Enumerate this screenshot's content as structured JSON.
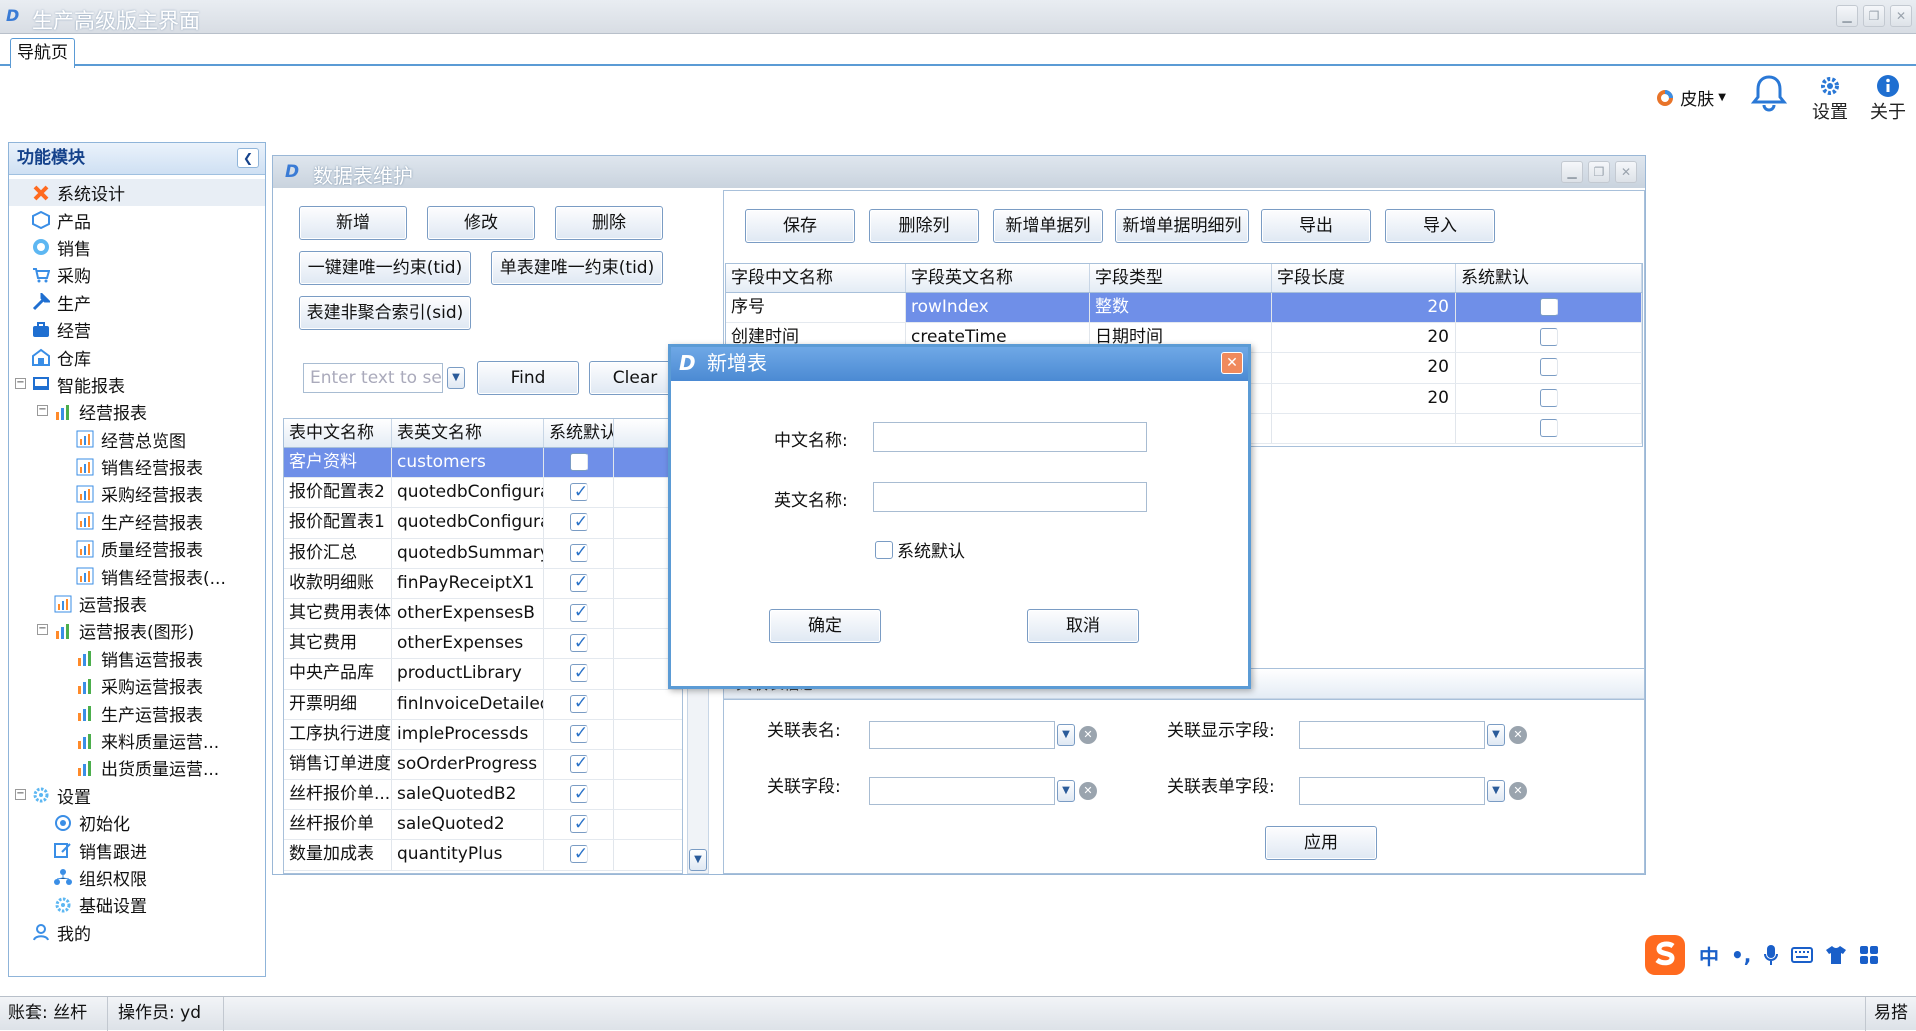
{
  "window": {
    "title": "生产高级版主界面"
  },
  "tabs": [
    {
      "label": "导航页"
    }
  ],
  "top_toolbar": {
    "skin": "皮肤",
    "settings": "设置",
    "about": "关于"
  },
  "left_panel": {
    "header": "功能模块",
    "tree": [
      {
        "label": "系统设计",
        "level": 1,
        "icon": "system-design-icon",
        "selected": true
      },
      {
        "label": "产品",
        "level": 1,
        "icon": "product-icon"
      },
      {
        "label": "销售",
        "level": 1,
        "icon": "sales-icon"
      },
      {
        "label": "采购",
        "level": 1,
        "icon": "cart-icon"
      },
      {
        "label": "生产",
        "level": 1,
        "icon": "tools-icon"
      },
      {
        "label": "经营",
        "level": 1,
        "icon": "briefcase-icon"
      },
      {
        "label": "仓库",
        "level": 1,
        "icon": "warehouse-icon"
      },
      {
        "label": "智能报表",
        "level": 1,
        "icon": "report-icon"
      },
      {
        "label": "经营报表",
        "level": 2,
        "icon": "bar-chart-icon"
      },
      {
        "label": "经营总览图",
        "level": 3,
        "icon": "chart-icon"
      },
      {
        "label": "销售经营报表",
        "level": 3,
        "icon": "chart-icon"
      },
      {
        "label": "采购经营报表",
        "level": 3,
        "icon": "chart-icon"
      },
      {
        "label": "生产经营报表",
        "level": 3,
        "icon": "chart-icon"
      },
      {
        "label": "质量经营报表",
        "level": 3,
        "icon": "chart-icon"
      },
      {
        "label": "销售经营报表(...",
        "level": 3,
        "icon": "chart-icon"
      },
      {
        "label": "运营报表",
        "level": 2,
        "icon": "chart-icon"
      },
      {
        "label": "运营报表(图形)",
        "level": 2,
        "icon": "bar-chart-icon"
      },
      {
        "label": "销售运营报表",
        "level": 3,
        "icon": "bar-chart-icon"
      },
      {
        "label": "采购运营报表",
        "level": 3,
        "icon": "bar-chart-icon"
      },
      {
        "label": "生产运营报表",
        "level": 3,
        "icon": "bar-chart-icon"
      },
      {
        "label": "来料质量运营...",
        "level": 3,
        "icon": "bar-chart-icon"
      },
      {
        "label": "出货质量运营...",
        "level": 3,
        "icon": "bar-chart-icon"
      },
      {
        "label": "设置",
        "level": 1,
        "icon": "gear-icon"
      },
      {
        "label": "初始化",
        "level": 2,
        "icon": "init-icon"
      },
      {
        "label": "销售跟进",
        "level": 2,
        "icon": "edit-icon"
      },
      {
        "label": "组织权限",
        "level": 2,
        "icon": "org-icon"
      },
      {
        "label": "基础设置",
        "level": 2,
        "icon": "gear-icon"
      },
      {
        "label": "我的",
        "level": 1,
        "icon": "user-icon"
      }
    ]
  },
  "data_window": {
    "title": "数据表维护",
    "left_buttons": {
      "add": "新增",
      "edit": "修改",
      "delete": "删除",
      "unique_tid": "一键建唯一约束(tid)",
      "single_unique_tid": "单表建唯一约束(tid)",
      "nonclustered_sid": "表建非聚合索引(sid)"
    },
    "search": {
      "placeholder": "Enter text to se",
      "find": "Find",
      "clear": "Clear"
    },
    "table_list": {
      "headers": [
        "表中文名称",
        "表英文名称",
        "系统默认"
      ],
      "rows": [
        {
          "cn": "客户资料",
          "en": "customers",
          "default": false,
          "selected": true
        },
        {
          "cn": "报价配置表2",
          "en": "quotedbConfigura...",
          "default": true
        },
        {
          "cn": "报价配置表1",
          "en": "quotedbConfigura...",
          "default": true
        },
        {
          "cn": "报价汇总",
          "en": "quotedbSummary",
          "default": true
        },
        {
          "cn": "收款明细账",
          "en": "finPayReceiptX1",
          "default": true
        },
        {
          "cn": "其它费用表体",
          "en": "otherExpensesB",
          "default": true
        },
        {
          "cn": "其它费用",
          "en": "otherExpenses",
          "default": true
        },
        {
          "cn": "中央产品库",
          "en": "productLibrary",
          "default": true
        },
        {
          "cn": "开票明细",
          "en": "finInvoiceDetailed",
          "default": true
        },
        {
          "cn": "工序执行进度",
          "en": "impleProcessds",
          "default": true
        },
        {
          "cn": "销售订单进度",
          "en": "soOrderProgress",
          "default": true
        },
        {
          "cn": "丝杆报价单...",
          "en": "saleQuotedB2",
          "default": true
        },
        {
          "cn": "丝杆报价单",
          "en": "saleQuoted2",
          "default": true
        },
        {
          "cn": "数量加成表",
          "en": "quantityPlus",
          "default": true
        }
      ]
    },
    "right_buttons": {
      "save": "保存",
      "delete_col": "删除列",
      "add_single_col": "新增单据列",
      "add_detail_col": "新增单据明细列",
      "export": "导出",
      "import": "导入"
    },
    "field_grid": {
      "headers": [
        "字段中文名称",
        "字段英文名称",
        "字段类型",
        "字段长度",
        "系统默认"
      ],
      "rows": [
        {
          "cn": "序号",
          "en": "rowIndex",
          "type": "整数",
          "len": "20",
          "selected": true
        },
        {
          "cn": "创建时间",
          "en": "createTime",
          "type": "日期时间",
          "len": "20"
        },
        {
          "cn": "",
          "en": "",
          "type": "",
          "len": "20"
        },
        {
          "cn": "",
          "en": "",
          "type": "",
          "len": "20"
        },
        {
          "cn": "",
          "en": "",
          "type": "",
          "len": ""
        }
      ]
    },
    "relation": {
      "section_title": "关联表信息",
      "table_name": "关联表名:",
      "display_field": "关联显示字段:",
      "field": "关联字段:",
      "form_field": "关联表单字段:",
      "apply": "应用"
    }
  },
  "dialog": {
    "title": "新增表",
    "cn_name_label": "中文名称:",
    "en_name_label": "英文名称:",
    "system_default": "系统默认",
    "ok": "确定",
    "cancel": "取消"
  },
  "ime": {
    "mode": "中"
  },
  "status": {
    "account": "账套: 丝杆",
    "operator": "操作员: yd",
    "brand": "易搭"
  }
}
